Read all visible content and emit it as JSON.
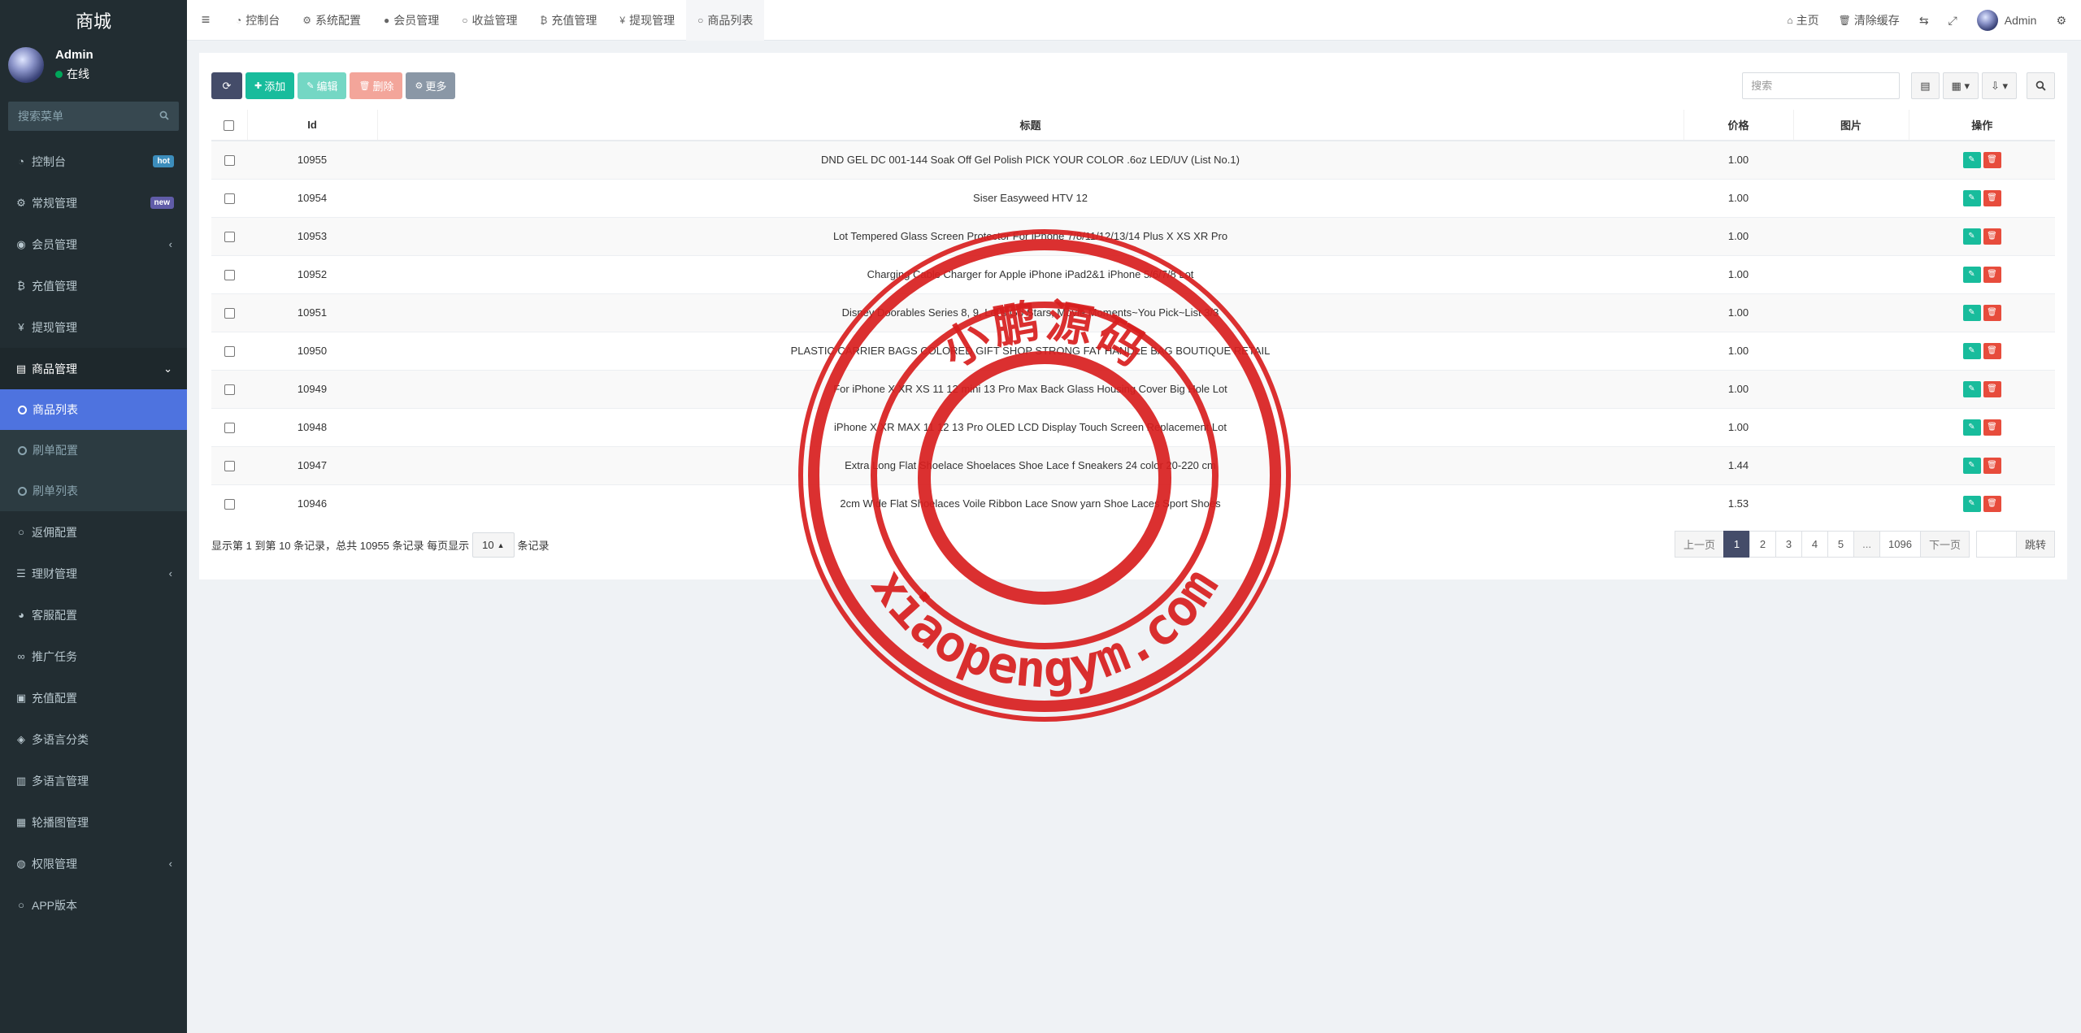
{
  "sidebar": {
    "brand": "商城",
    "user_name": "Admin",
    "user_status": "在线",
    "search_placeholder": "搜索菜单",
    "items": [
      {
        "label": "控制台",
        "icon": "dashboard-icon",
        "badge": "hot"
      },
      {
        "label": "常规管理",
        "icon": "cogs-icon",
        "badge": "new"
      },
      {
        "label": "会员管理",
        "icon": "user-circle-icon"
      },
      {
        "label": "充值管理",
        "icon": "bitcoin-icon"
      },
      {
        "label": "提现管理",
        "icon": "yen-icon"
      },
      {
        "label": "商品管理",
        "icon": "cart-icon"
      },
      {
        "label": "返佣配置",
        "icon": "circle-o-icon"
      },
      {
        "label": "理财管理",
        "icon": "list-icon"
      },
      {
        "label": "客服配置",
        "icon": "headset-icon"
      },
      {
        "label": "推广任务",
        "icon": "link-icon"
      },
      {
        "label": "充值配置",
        "icon": "image-icon"
      },
      {
        "label": "多语言分类",
        "icon": "tag-icon"
      },
      {
        "label": "多语言管理",
        "icon": "book-icon"
      },
      {
        "label": "轮播图管理",
        "icon": "picture-icon"
      },
      {
        "label": "权限管理",
        "icon": "group-icon"
      },
      {
        "label": "APP版本",
        "icon": "circle-o-icon"
      }
    ],
    "submenu": [
      "商品列表",
      "刷单配置",
      "刷单列表"
    ]
  },
  "navbar": {
    "tabs": [
      {
        "label": "控制台",
        "icon": "dashboard-icon"
      },
      {
        "label": "系统配置",
        "icon": "gear-icon"
      },
      {
        "label": "会员管理",
        "icon": "user-icon"
      },
      {
        "label": "收益管理",
        "icon": "circle-o-icon"
      },
      {
        "label": "充值管理",
        "icon": "bitcoin-icon"
      },
      {
        "label": "提现管理",
        "icon": "yen-icon"
      },
      {
        "label": "商品列表",
        "icon": "circle-o-icon"
      }
    ],
    "home": "主页",
    "clear_cache": "清除缓存",
    "admin": "Admin"
  },
  "toolbar": {
    "add": "添加",
    "edit": "编辑",
    "delete": "删除",
    "more": "更多",
    "search_placeholder": "搜索"
  },
  "table": {
    "headers": [
      "Id",
      "标题",
      "价格",
      "图片",
      "操作"
    ],
    "rows": [
      {
        "id": "10955",
        "title": "DND GEL DC 001-144 Soak Off Gel Polish PICK YOUR COLOR .6oz LED/UV (List No.1)",
        "price": "1.00"
      },
      {
        "id": "10954",
        "title": "Siser Easyweed HTV 12",
        "price": "1.00"
      },
      {
        "id": "10953",
        "title": "Lot Tempered Glass Screen Protector For iPhone 7/8/11/12/13/14 Plus X XS XR Pro",
        "price": "1.00"
      },
      {
        "id": "10952",
        "title": "Charging Cable Charger for Apple iPhone iPad2&1 iPhone 5/6/7/8 Lot",
        "price": "1.00"
      },
      {
        "id": "10951",
        "title": "Disney Doorables Series 8, 9, Let's Go Stars, Movie Moments~You Pick~List 3/3",
        "price": "1.00"
      },
      {
        "id": "10950",
        "title": "PLASTIC CARRIER BAGS COLORED GIFT SHOP STRONG FAT HANDLE BAG BOUTIQUE RETAIL",
        "price": "1.00"
      },
      {
        "id": "10949",
        "title": "For iPhone X XR XS 11 12 mini 13 Pro Max Back Glass Housing Cover Big Hole Lot",
        "price": "1.00"
      },
      {
        "id": "10948",
        "title": "iPhone X XR MAX 11 12 13 Pro OLED LCD Display Touch Screen Replacement Lot",
        "price": "1.00"
      },
      {
        "id": "10947",
        "title": "Extra Long Flat Shoelace Shoelaces Shoe Lace f Sneakers 24 color 20-220 cm",
        "price": "1.44"
      },
      {
        "id": "10946",
        "title": "2cm Wide Flat Shoelaces Voile Ribbon Lace Snow yarn Shoe Laces Sport Shoes",
        "price": "1.53"
      }
    ]
  },
  "footer": {
    "summary": "显示第 1 到第 10 条记录，总共 10955 条记录 每页显示",
    "page_size": "10",
    "suffix": "条记录",
    "prev": "上一页",
    "pages": [
      "1",
      "2",
      "3",
      "4",
      "5",
      "...",
      "1096"
    ],
    "next": "下一页",
    "jump": "跳转"
  },
  "watermark": {
    "top_text": "小鹏源码",
    "bottom_text": "xiaopengym.com",
    "color": "#d81e1e"
  }
}
